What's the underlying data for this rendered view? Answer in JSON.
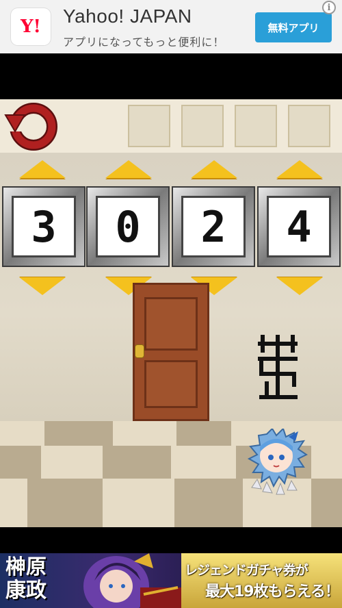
{
  "top_ad": {
    "logo_text": "Y!",
    "title": "Yahoo! JAPAN",
    "subtitle": "アプリになってもっと便利に！",
    "button_label": "無料アプリ",
    "info_glyph": "i"
  },
  "game": {
    "back_icon": "refresh-arrow-icon",
    "inventory_slots": [
      "",
      "",
      "",
      ""
    ],
    "digits": [
      "3",
      "0",
      "2",
      "4"
    ],
    "colors": {
      "arrow": "#f4c11e",
      "door": "#9a4c28",
      "back": "#b02020"
    }
  },
  "bottom_ad": {
    "kanji_line1": "榊原",
    "kanji_line2": "康政",
    "line1": "レジェンドガチャ券が",
    "line2": "最大19枚もらえる！"
  }
}
